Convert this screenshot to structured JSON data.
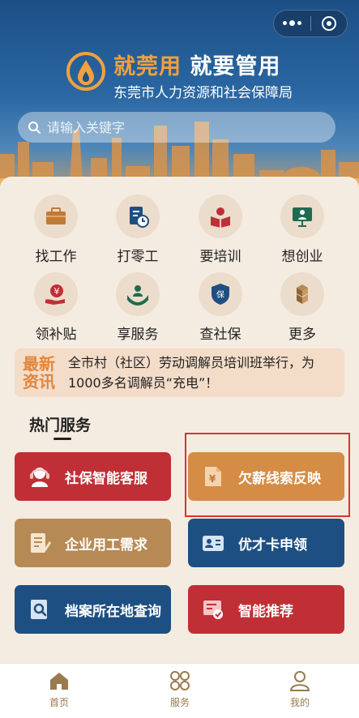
{
  "header": {
    "slogan_accent": "就莞用",
    "slogan_rest": "就要管用",
    "bureau": "东莞市人力资源和社会保障局"
  },
  "search": {
    "placeholder": "请输入关键字"
  },
  "grid": [
    {
      "label": "找工作",
      "icon": "briefcase-icon"
    },
    {
      "label": "打零工",
      "icon": "clock-document-icon"
    },
    {
      "label": "要培训",
      "icon": "reading-icon"
    },
    {
      "label": "想创业",
      "icon": "presenter-icon"
    },
    {
      "label": "领补贴",
      "icon": "yuan-hand-icon"
    },
    {
      "label": "享服务",
      "icon": "service-person-icon"
    },
    {
      "label": "查社保",
      "icon": "shield-icon"
    },
    {
      "label": "更多",
      "icon": "cubes-icon"
    }
  ],
  "news": {
    "tag_line1": "最新",
    "tag_line2": "资讯",
    "text": "全市村（社区）劳动调解员培训班举行，为1000多名调解员“充电”！"
  },
  "section": {
    "title": "热门服务"
  },
  "services": [
    {
      "label": "社保智能客服",
      "icon": "headset-agent-icon"
    },
    {
      "label": "欠薪线索反映",
      "icon": "yuan-document-icon"
    },
    {
      "label": "企业用工需求",
      "icon": "form-pen-icon"
    },
    {
      "label": "优才卡申领",
      "icon": "id-card-icon"
    },
    {
      "label": "档案所在地查询",
      "icon": "search-document-icon"
    },
    {
      "label": "智能推荐",
      "icon": "recommend-icon"
    }
  ],
  "tabbar": [
    {
      "label": "首页",
      "icon": "home-icon"
    },
    {
      "label": "服务",
      "icon": "grid-icon"
    },
    {
      "label": "我的",
      "icon": "user-icon"
    }
  ],
  "colors": {
    "header_blue": "#1c4f86",
    "accent_orange": "#f2a03d",
    "service_red": "#c02f35",
    "service_orange": "#d58c45",
    "service_brown": "#b78a55",
    "service_blue": "#1e4f82",
    "highlight_red": "#e0322e",
    "tab_gold": "#9b7a4e"
  }
}
